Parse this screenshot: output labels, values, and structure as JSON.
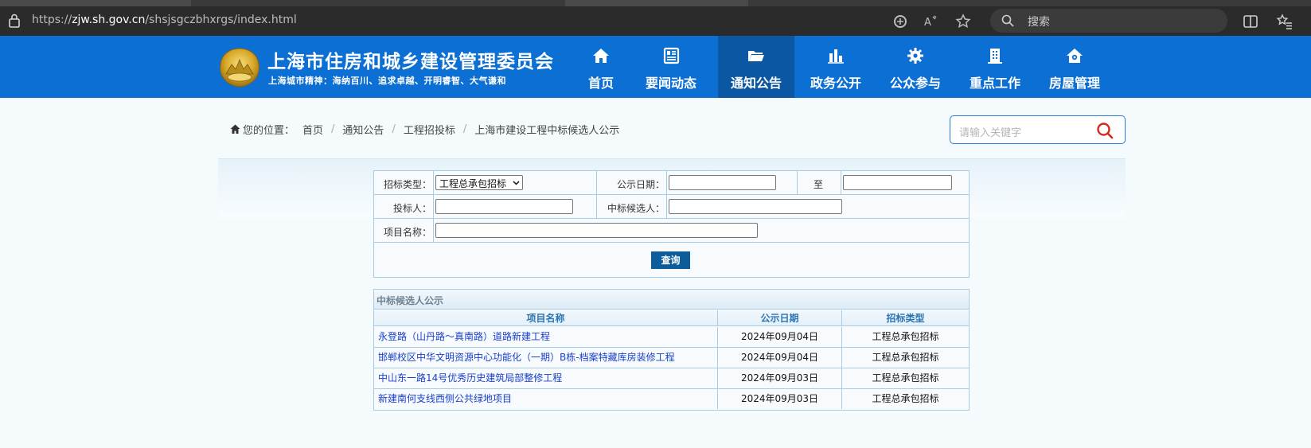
{
  "browser": {
    "url_prefix": "https://",
    "url_host": "zjw.sh.gov.cn",
    "url_path": "/shsjsgczbhxrgs/index.html",
    "search_placeholder": "搜索"
  },
  "header": {
    "title": "上海市住房和城乡建设管理委员会",
    "motto": "上海城市精神：海纳百川、追求卓越、开明睿智、大气谦和",
    "nav": [
      {
        "label": "首页",
        "icon": "home-icon"
      },
      {
        "label": "要闻动态",
        "icon": "news-icon"
      },
      {
        "label": "通知公告",
        "icon": "folder-icon",
        "active": true
      },
      {
        "label": "政务公开",
        "icon": "bar-chart-icon"
      },
      {
        "label": "公众参与",
        "icon": "gear-icon"
      },
      {
        "label": "重点工作",
        "icon": "building-icon"
      },
      {
        "label": "房屋管理",
        "icon": "house-gear-icon"
      }
    ]
  },
  "breadcrumb": {
    "prefix": "您的位置：",
    "items": [
      "首页",
      "通知公告",
      "工程招投标",
      "上海市建设工程中标候选人公示"
    ],
    "separator": "/"
  },
  "site_search": {
    "placeholder": "请输入关键字"
  },
  "form": {
    "bid_type_label": "招标类型：",
    "bid_type_value": "工程总承包招标",
    "date_label": "公示日期：",
    "date_from": "",
    "to_label": "至",
    "date_to": "",
    "bidder_label": "投标人：",
    "bidder_value": "",
    "candidate_label": "中标候选人：",
    "candidate_value": "",
    "project_label": "项目名称：",
    "project_value": "",
    "query_button": "查询"
  },
  "results": {
    "title": "中标候选人公示",
    "columns": [
      "项目名称",
      "公示日期",
      "招标类型"
    ],
    "rows": [
      {
        "name": "永登路（山丹路～真南路）道路新建工程",
        "date": "2024年09月04日",
        "type": "工程总承包招标"
      },
      {
        "name": "邯郸校区中华文明资源中心功能化（一期）B栋-档案特藏库房装修工程",
        "date": "2024年09月04日",
        "type": "工程总承包招标"
      },
      {
        "name": "中山东一路14号优秀历史建筑局部整修工程",
        "date": "2024年09月03日",
        "type": "工程总承包招标"
      },
      {
        "name": "新建南何支线西侧公共绿地项目",
        "date": "2024年09月03日",
        "type": "工程总承包招标"
      }
    ]
  },
  "colors": {
    "header_blue": "#0c6fd4",
    "nav_active": "#0b57a3",
    "link_blue": "#1a3fc9",
    "button_blue": "#0e5d9a",
    "search_accent": "#d9261c"
  }
}
